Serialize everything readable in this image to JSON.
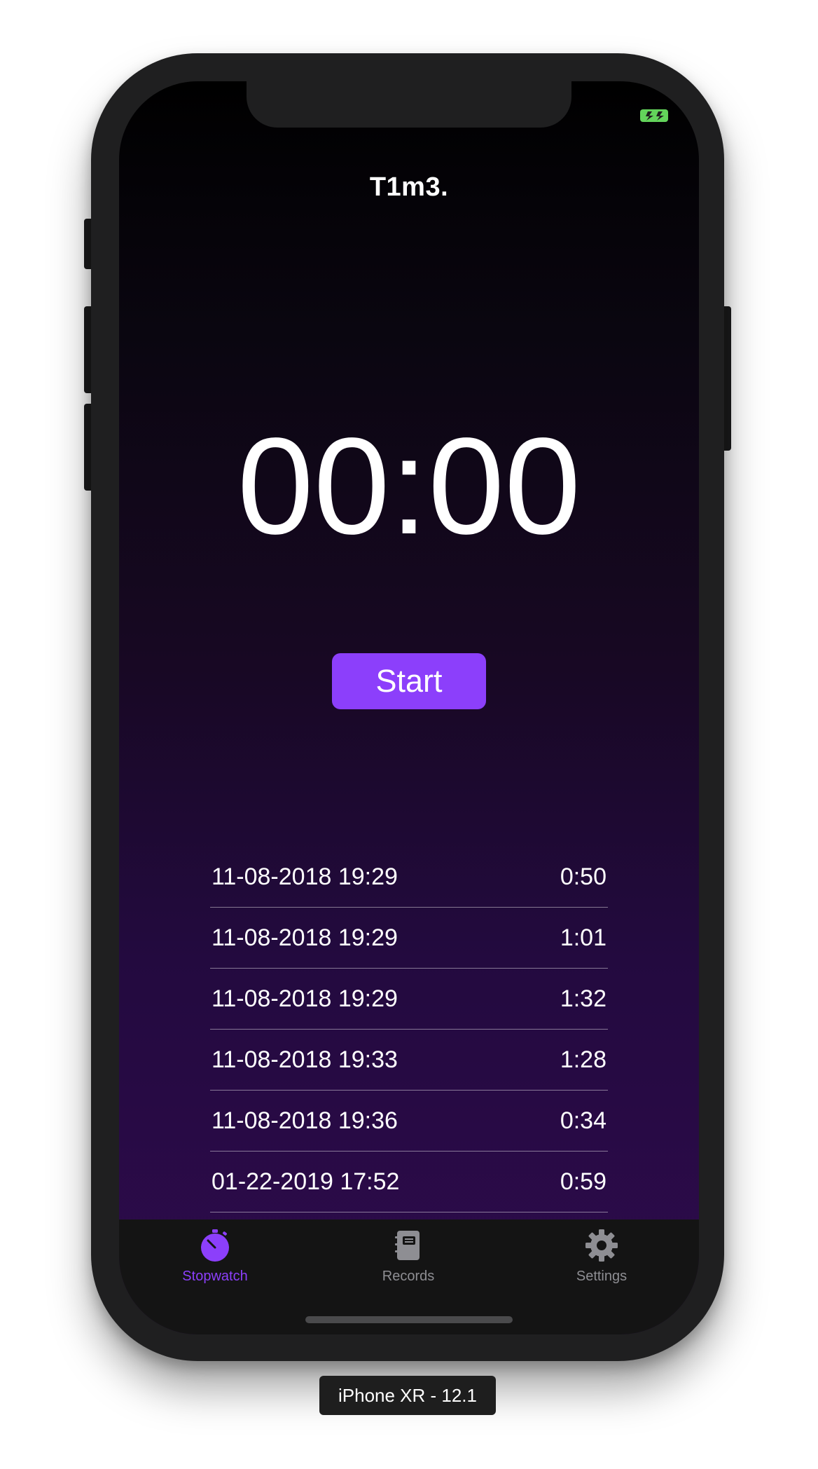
{
  "status_bar": {
    "battery_icon": "battery-charging-icon",
    "battery_color": "#63d45b"
  },
  "app": {
    "title": "T1m3.",
    "timer": "00:00",
    "start_label": "Start",
    "accent_color": "#8c3ffb"
  },
  "records": [
    {
      "date": "11-08-2018 19:29",
      "duration": "0:50"
    },
    {
      "date": "11-08-2018 19:29",
      "duration": "1:01"
    },
    {
      "date": "11-08-2018 19:29",
      "duration": "1:32"
    },
    {
      "date": "11-08-2018 19:33",
      "duration": "1:28"
    },
    {
      "date": "11-08-2018 19:36",
      "duration": "0:34"
    },
    {
      "date": "01-22-2019 17:52",
      "duration": "0:59"
    }
  ],
  "tab_bar": {
    "tabs": [
      {
        "label": "Stopwatch",
        "icon": "stopwatch-icon",
        "selected": true
      },
      {
        "label": "Records",
        "icon": "notebook-icon",
        "selected": false
      },
      {
        "label": "Settings",
        "icon": "gear-icon",
        "selected": false
      }
    ]
  },
  "device_label": "iPhone XR - 12.1"
}
